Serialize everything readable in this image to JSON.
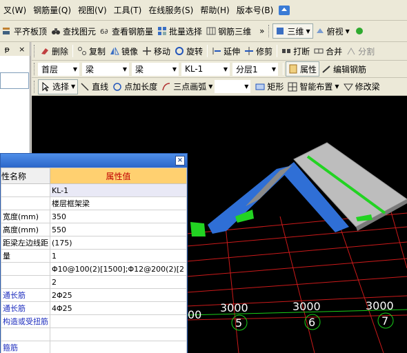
{
  "menubar": {
    "items": [
      "叉(W)",
      "钢筋量(Q)",
      "视图(V)",
      "工具(T)",
      "在线服务(S)",
      "帮助(H)",
      "版本号(B)"
    ]
  },
  "toolbar1": {
    "items": [
      "平齐板顶",
      "查找图元",
      "查看钢筋量",
      "批量选择",
      "钢筋三维"
    ],
    "more": "»",
    "view_3d": "三维",
    "view_top": "俯视"
  },
  "left_panel": {
    "pin": "ᵽ",
    "close": "×"
  },
  "toolbar2": {
    "items": [
      "删除",
      "复制",
      "镜像",
      "移动",
      "旋转",
      "延伸",
      "修剪",
      "打断",
      "合并",
      "分割"
    ]
  },
  "toolbar3": {
    "floor": "首层",
    "type": "梁",
    "subtype": "梁",
    "element": "KL-1",
    "layer": "分层1",
    "properties": "属性",
    "edit_rebar": "编辑钢筋"
  },
  "toolbar4": {
    "select": "选择",
    "line": "直线",
    "point_length": "点加长度",
    "three_point_arc": "三点画弧",
    "rect": "矩形",
    "smart_layout": "智能布置",
    "modify": "修改梁"
  },
  "viewport": {
    "grid_numbers": [
      "5",
      "6",
      "7"
    ],
    "dimensions": [
      "3000",
      "3000",
      "3000"
    ],
    "left_dim": "00"
  },
  "properties_window": {
    "close": "×",
    "header": {
      "name": "性名称",
      "value": "属性值"
    },
    "rows": [
      {
        "key": "",
        "value": "KL-1"
      },
      {
        "key": "",
        "value": "楼层框架梁"
      },
      {
        "key": "宽度(mm)",
        "value": "350"
      },
      {
        "key": "高度(mm)",
        "value": "550"
      },
      {
        "key": "距梁左边线距",
        "value": "(175)"
      },
      {
        "key": "量",
        "value": "1"
      },
      {
        "key": "",
        "value": "Φ10@100(2)[1500];Φ12@200(2)[2"
      },
      {
        "key": "",
        "value": "2"
      },
      {
        "key": "通长筋",
        "value": "2Φ25"
      },
      {
        "key": "通长筋",
        "value": "4Φ25"
      },
      {
        "key": "构造或受扭筋",
        "value": ""
      },
      {
        "key": "",
        "value": ""
      },
      {
        "key": "箍筋",
        "value": ""
      }
    ]
  },
  "colors": {
    "beam_blue": "#2f6fd6",
    "rebar_green": "#22d322",
    "slab_gray": "#bdbdbd",
    "grid_red": "#cc1a1a",
    "axis_green": "#19d219"
  }
}
